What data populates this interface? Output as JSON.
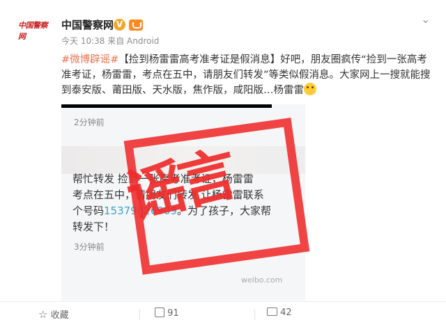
{
  "header": {
    "logo_text": "中国警察网",
    "account_name": "中国警察网",
    "verified_mark": "V",
    "meta": "今天 10:38 来自 Android",
    "menu_icon": "chevron-down-icon"
  },
  "post": {
    "hashtag": "#微博辟谣#",
    "text": "【捡到杨雷雷高考准考证是假消息】好吧，朋友圈疯传“捡到一张高考准考证，杨雷雷，考点在五中，请朋友们转发”等类似假消息。大家网上一搜就能搜到泰安版、莆田版、天水版，焦作版，咸阳版…杨雷雷"
  },
  "screenshot": {
    "time_top": "2分钟前",
    "line1": "帮忙转发 捡到一张高考准考证，杨雷雷",
    "line2": "考点在五中，请朋友们转发 让杨雷雷联系",
    "line3_a": "个号码",
    "phone": "15379826909",
    "line3_b": "。为了孩子，大家帮",
    "line4": "转发下！",
    "time_bottom": "3分钟前",
    "stamp": "谣言",
    "watermark": "weibo.com"
  },
  "footer": {
    "favorite_label": "收藏",
    "repost_count": "91",
    "comment_count": "42"
  }
}
